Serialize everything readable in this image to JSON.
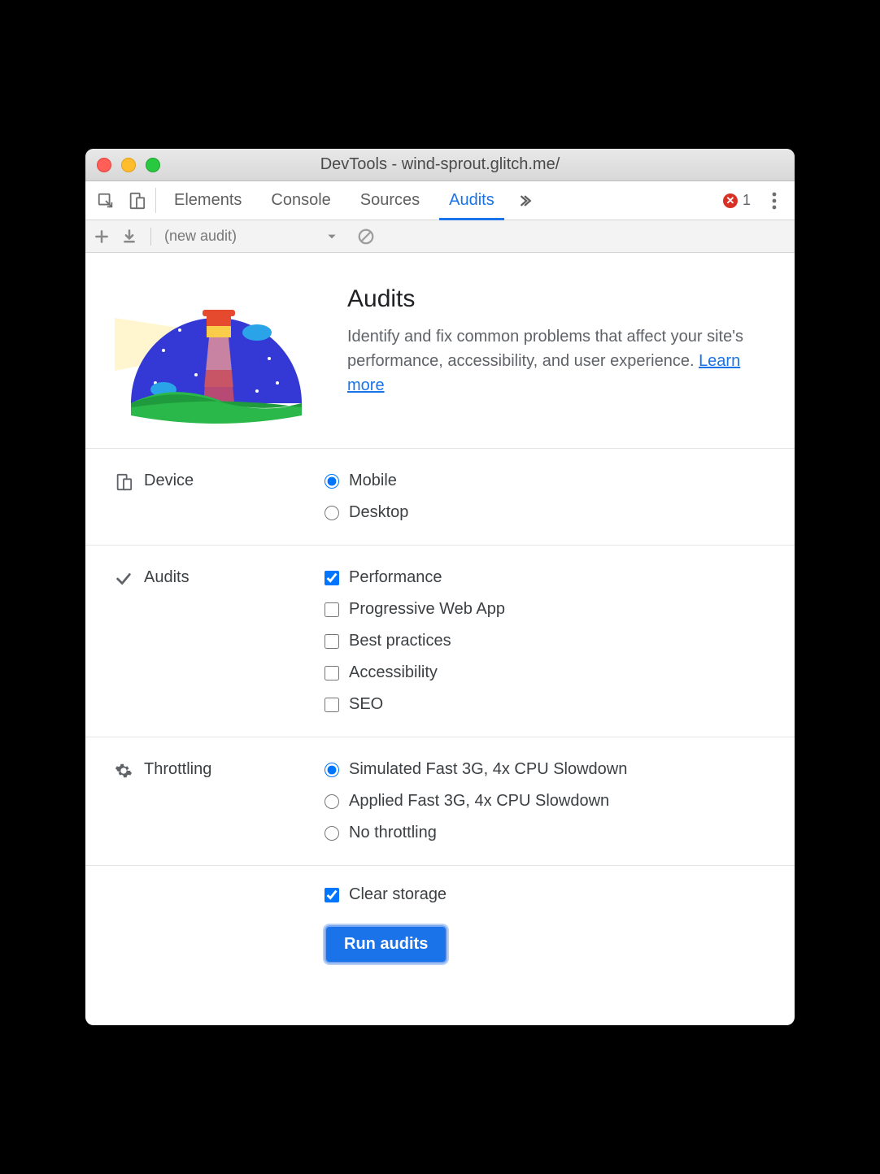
{
  "window_title": "DevTools - wind-sprout.glitch.me/",
  "tabs": {
    "items": [
      "Elements",
      "Console",
      "Sources",
      "Audits"
    ],
    "active_index": 3
  },
  "error_count": "1",
  "toolbar": {
    "select_label": "(new audit)"
  },
  "hero": {
    "title": "Audits",
    "description": "Identify and fix common problems that affect your site's performance, accessibility, and user experience. ",
    "learn_more": "Learn more"
  },
  "sections": {
    "device": {
      "label": "Device",
      "options": [
        {
          "label": "Mobile",
          "checked": true
        },
        {
          "label": "Desktop",
          "checked": false
        }
      ]
    },
    "audits": {
      "label": "Audits",
      "options": [
        {
          "label": "Performance",
          "checked": true
        },
        {
          "label": "Progressive Web App",
          "checked": false
        },
        {
          "label": "Best practices",
          "checked": false
        },
        {
          "label": "Accessibility",
          "checked": false
        },
        {
          "label": "SEO",
          "checked": false
        }
      ]
    },
    "throttling": {
      "label": "Throttling",
      "options": [
        {
          "label": "Simulated Fast 3G, 4x CPU Slowdown",
          "checked": true
        },
        {
          "label": "Applied Fast 3G, 4x CPU Slowdown",
          "checked": false
        },
        {
          "label": "No throttling",
          "checked": false
        }
      ]
    }
  },
  "clear_storage": {
    "label": "Clear storage",
    "checked": true
  },
  "run_button": "Run audits"
}
